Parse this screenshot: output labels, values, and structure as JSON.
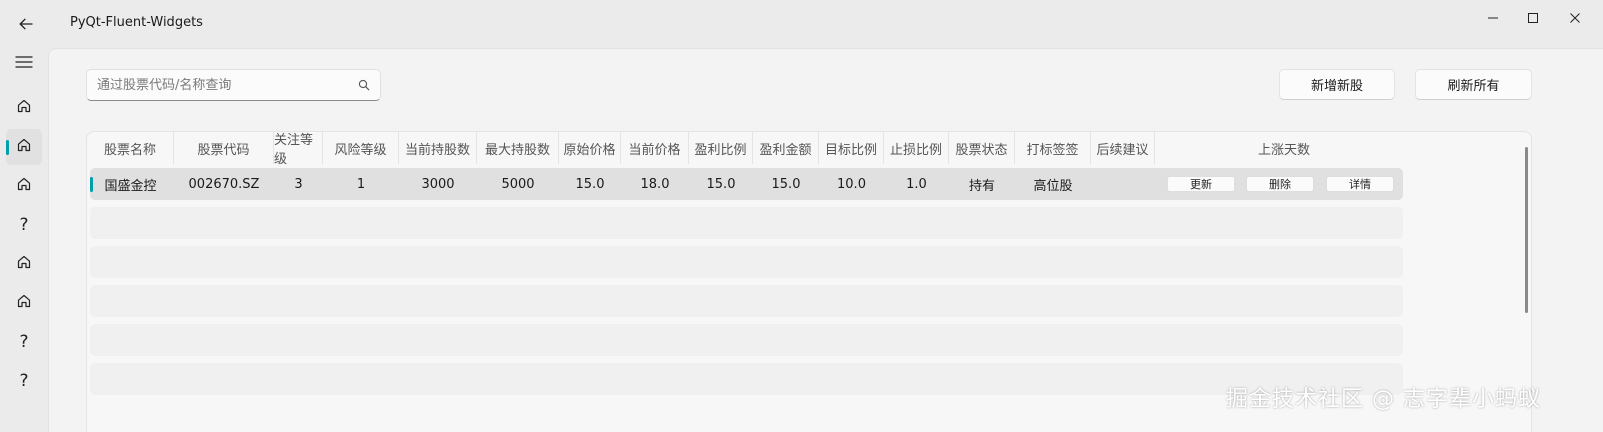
{
  "window": {
    "title": "PyQt-Fluent-Widgets"
  },
  "nav": {
    "items": [
      {
        "icon": "home-icon"
      },
      {
        "icon": "home-icon",
        "selected": true
      },
      {
        "icon": "home-icon"
      },
      {
        "icon": "help-icon",
        "glyph": "?"
      },
      {
        "icon": "home-icon"
      },
      {
        "icon": "home-icon"
      },
      {
        "icon": "help-icon",
        "glyph": "?"
      },
      {
        "icon": "help-icon",
        "glyph": "?"
      }
    ]
  },
  "search": {
    "placeholder": "通过股票代码/名称查询",
    "value": ""
  },
  "toolbar": {
    "add_label": "新增新股",
    "refresh_label": "刷新所有"
  },
  "table": {
    "headers": [
      "股票名称",
      "股票代码",
      "关注等级",
      "风险等级",
      "当前持股数",
      "最大持股数",
      "原始价格",
      "当前价格",
      "盈利比例",
      "盈利金额",
      "目标比例",
      "止损比例",
      "股票状态",
      "打标签签",
      "后续建议",
      "上涨天数"
    ],
    "rows": [
      {
        "cells": [
          "国盛金控",
          "002670.SZ",
          "3",
          "1",
          "3000",
          "5000",
          "15.0",
          "18.0",
          "15.0",
          "15.0",
          "10.0",
          "1.0",
          "持有",
          "高位股",
          ""
        ],
        "actions": [
          "更新",
          "删除",
          "详情"
        ]
      }
    ]
  },
  "watermark": "掘金技术社区 @ 志字辈小蚂蚁",
  "colors": {
    "accent": "#009faa",
    "background": "#f3f3f3",
    "titlebar": "#ebebeb"
  }
}
